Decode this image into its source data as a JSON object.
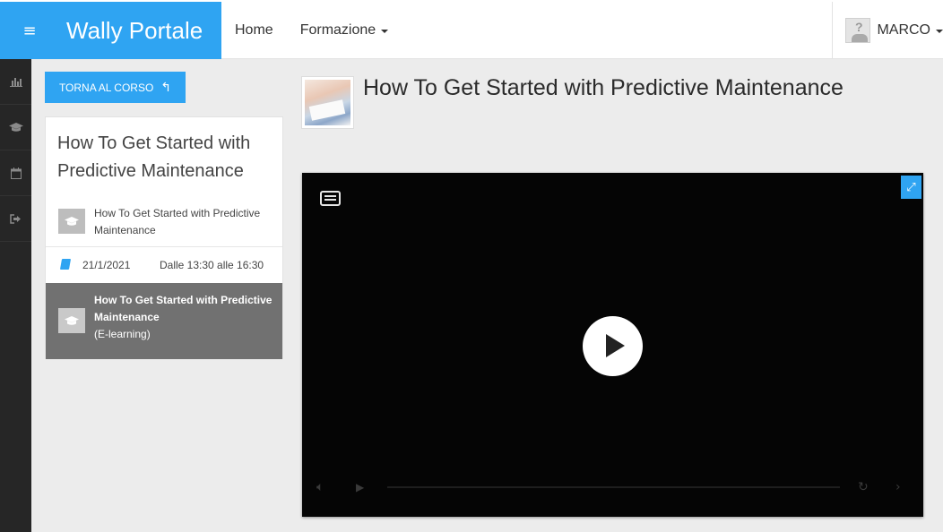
{
  "header": {
    "menu_glyph": "≡",
    "brand": "Wally Portale",
    "nav": [
      {
        "label": "Home"
      },
      {
        "label": "Formazione"
      }
    ],
    "user": {
      "name": "MARCO"
    }
  },
  "rail": {
    "icons": [
      "bar-chart-icon",
      "graduation-cap-icon",
      "calendar-icon",
      "sign-out-icon"
    ]
  },
  "back_button": {
    "label": "TORNA AL CORSO",
    "icon": "reply-arrow-icon"
  },
  "course": {
    "title": "How To Get Started with Predictive Maintenance",
    "module": {
      "label": "How To Get Started with Predictive Maintenance"
    },
    "session": {
      "date": "21/1/2021",
      "time": "Dalle 13:30 alle 16:30"
    },
    "active": {
      "title": "How To Get Started with Predictive Maintenance",
      "type": "(E-learning)"
    }
  },
  "content": {
    "title": "How To Get Started with Predictive Maintenance"
  },
  "player": {
    "expand_glyph": "⤢",
    "accent": "#2fa4f2"
  },
  "colors": {
    "accent": "#2fa4f2",
    "rail": "#262626",
    "active_item": "#717171"
  }
}
